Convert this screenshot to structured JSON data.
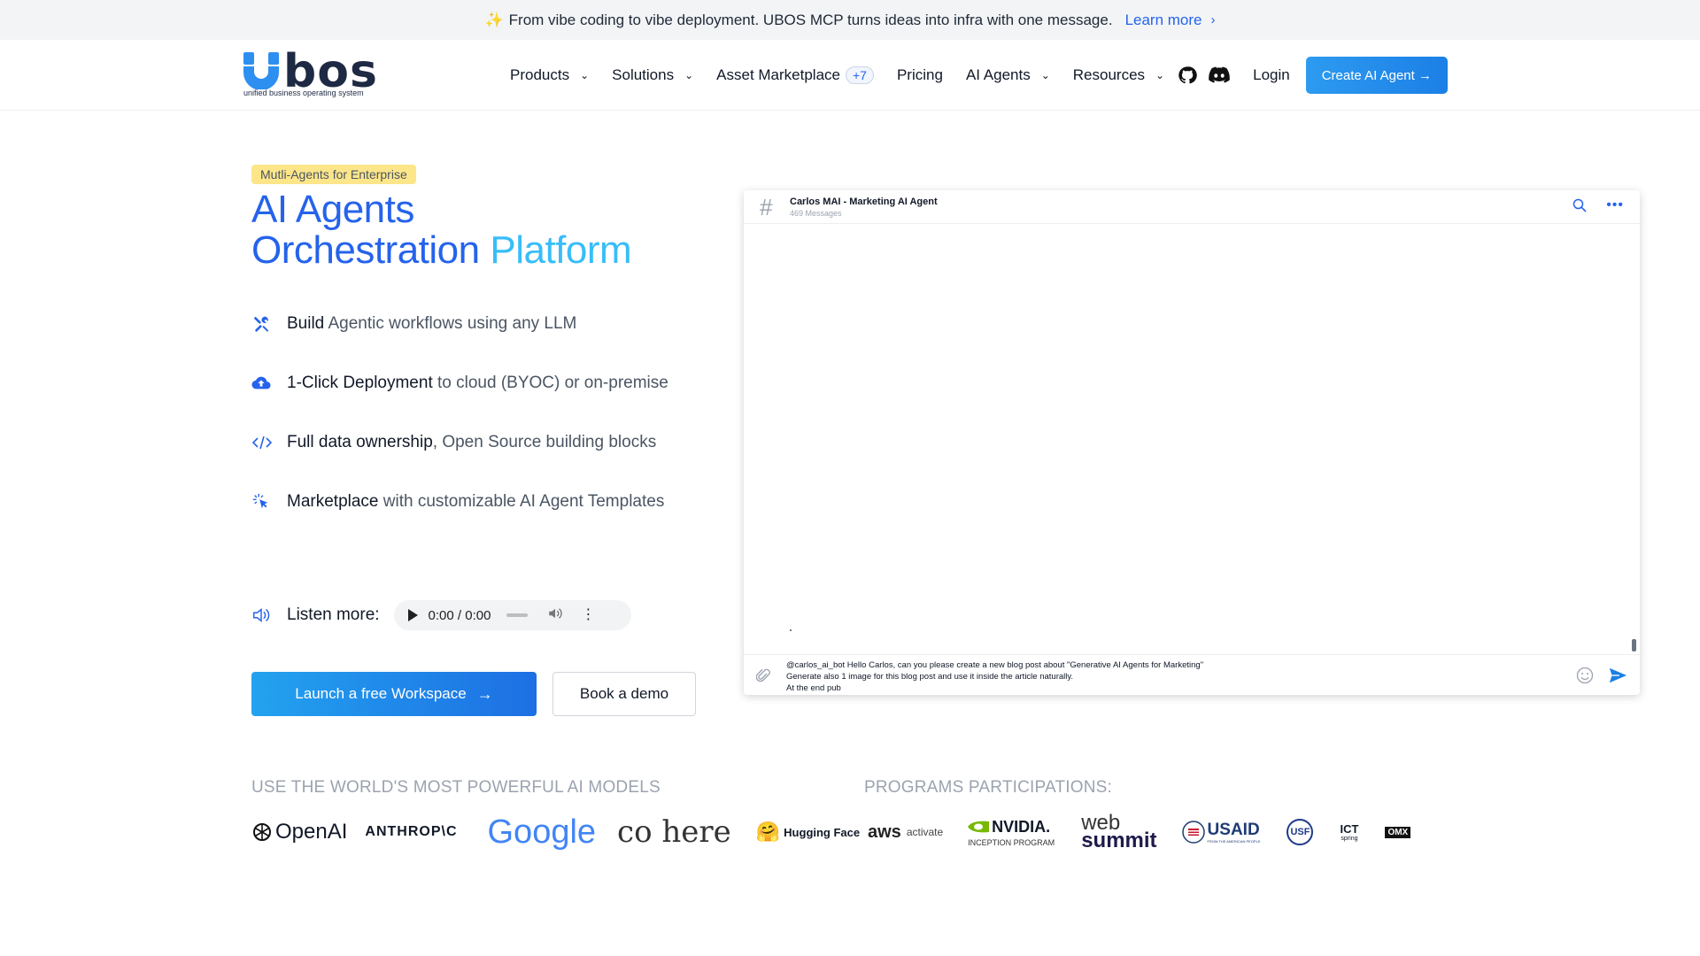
{
  "announcement": {
    "text": "From vibe coding to vibe deployment. UBOS MCP turns ideas into infra with one message.",
    "link": "Learn more"
  },
  "brand": {
    "name": "bos",
    "tagline": "unified business operating system"
  },
  "nav": {
    "products": "Products",
    "solutions": "Solutions",
    "marketplace": "Asset Marketplace",
    "marketplace_badge": "+7",
    "pricing": "Pricing",
    "agents": "AI Agents",
    "resources": "Resources",
    "login": "Login",
    "cta": "Create AI Agent →"
  },
  "hero": {
    "pill": "Mutli-Agents for Enterprise",
    "title_line1": "AI Agents",
    "title_line2a": "Orchestration ",
    "title_line2b": "Platform",
    "features": [
      {
        "strong": "Build",
        "rest": " Agentic workflows using any LLM"
      },
      {
        "strong": "1-Click Deployment",
        "rest": " to cloud (BYOC) or on-premise"
      },
      {
        "strong": "Full data ownership",
        "rest": ", Open Source building blocks"
      },
      {
        "strong": "Marketplace",
        "rest": " with customizable AI Agent Templates"
      }
    ],
    "listen_label": "Listen more:",
    "player_time": "0:00 / 0:00",
    "primary_button": "Launch a free Workspace",
    "secondary_button": "Book a demo"
  },
  "chat": {
    "title": "Carlos MAI - Marketing AI Agent",
    "subtitle": "469 Messages",
    "message_lines": [
      "@carlos_ai_bot Hello Carlos, can you please create a new blog post about \"Generative AI Agents for Marketing\"",
      "Generate also 1 image for this blog post and use it inside the article naturally.",
      "At the end pub"
    ]
  },
  "models": {
    "label": "USE THE WORLD'S MOST POWERFUL AI MODELS",
    "openai": "OpenAI",
    "anthropic": "ANTHROP\\C",
    "google": "Google",
    "cohere": "co here",
    "hugging": "Hugging Face"
  },
  "programs": {
    "label": "PROGRAMS PARTICIPATIONS:",
    "aws": "aws",
    "aws_sub": "activate",
    "nvidia": "NVIDIA.",
    "nvidia_sub": "INCEPTION PROGRAM",
    "web": "web",
    "summit": "summit",
    "usaid": "USAID",
    "usaid_sub": "FROM THE AMERICAN PEOPLE",
    "usf": "USF",
    "ict": "ICT",
    "ict_sub": "spring",
    "omx": "OMX"
  }
}
